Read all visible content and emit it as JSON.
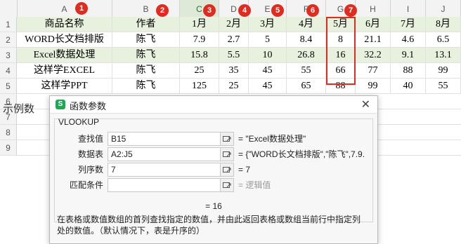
{
  "sheet": {
    "columns": [
      "A",
      "B",
      "C",
      "D",
      "E",
      "F",
      "G",
      "H",
      "I",
      "J"
    ],
    "rows": [
      "1",
      "2",
      "3",
      "4",
      "5",
      "6",
      "7",
      "8",
      "9"
    ],
    "header": [
      "商品名称",
      "作者",
      "1月",
      "2月",
      "3月",
      "4月",
      "5月",
      "6月",
      "7月",
      "8月"
    ],
    "data": [
      [
        "WORD长文档排版",
        "陈飞",
        "7.9",
        "2.7",
        "5",
        "8.4",
        "8",
        "21.1",
        "4.6",
        "6.5"
      ],
      [
        "Excel数据处理",
        "陈飞",
        "15.8",
        "5.5",
        "10",
        "26.8",
        "16",
        "32.2",
        "9.1",
        "13.1"
      ],
      [
        "这样学EXCEL",
        "陈飞",
        "25",
        "35",
        "45",
        "55",
        "66",
        "77",
        "88",
        "99"
      ],
      [
        "这样学PPT",
        "陈飞",
        "125",
        "25",
        "45",
        "65",
        "88",
        "99",
        "40",
        "55"
      ]
    ],
    "note_text": "示例数",
    "badges": [
      "1",
      "2",
      "3",
      "4",
      "5",
      "6",
      "7"
    ],
    "colors": {
      "header_green": "#e8f1dd",
      "badge_red": "#e02b20",
      "selected_col": "#dfe9d7"
    }
  },
  "dialog": {
    "title": "函数参数",
    "logo": "S",
    "close_icon": "close-icon",
    "function_name": "VLOOKUP",
    "args": [
      {
        "label": "查找值",
        "value": "B15",
        "result": "= \"Excel数据处理\""
      },
      {
        "label": "数据表",
        "value": "A2:J5",
        "result": "= {\"WORD长文档排版\",\"陈飞\",7.9..."
      },
      {
        "label": "列序数",
        "value": "7",
        "result": "= 7"
      },
      {
        "label": "匹配条件",
        "value": "",
        "result": "= 逻辑值"
      }
    ],
    "total_result": "= 16",
    "description": "在表格或数值数组的首列查找指定的数值，并由此返回表格或数组当前行中指定列处的数值。（默认情况下，表是升序的）"
  }
}
